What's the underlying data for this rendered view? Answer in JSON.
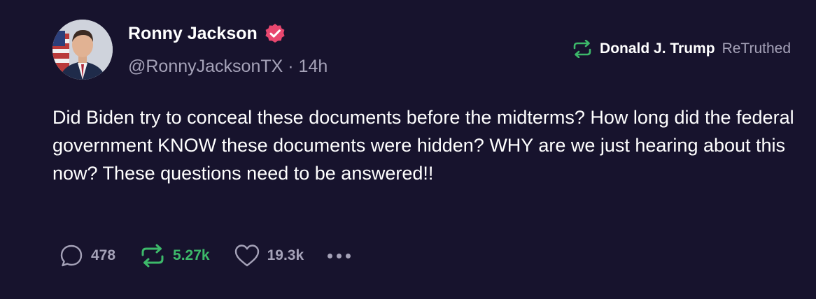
{
  "post": {
    "author": {
      "name": "Ronny Jackson",
      "handle": "@RonnyJacksonTX",
      "separator": "·",
      "time": "14h",
      "verified_icon": "verified-badge-icon",
      "verified_color": "#e8476f"
    },
    "retruth": {
      "user": "Donald J. Trump",
      "label": "ReTruthed",
      "icon": "retruth-icon",
      "icon_color": "#3db96a"
    },
    "text": "Did Biden try to conceal these documents before the midterms? How long did the federal government KNOW these documents were hidden? WHY are we just hearing about this now? These questions need to be answered!!",
    "actions": {
      "replies": "478",
      "retruths": "5.27k",
      "likes": "19.3k",
      "reply_icon": "reply-icon",
      "retruth_icon": "retruth-icon",
      "like_icon": "heart-icon",
      "more_icon": "more-options-icon"
    }
  },
  "colors": {
    "background": "#17132d",
    "muted_text": "#a5a2b8",
    "accent_green": "#3db96a",
    "verified_pink": "#e8476f"
  }
}
